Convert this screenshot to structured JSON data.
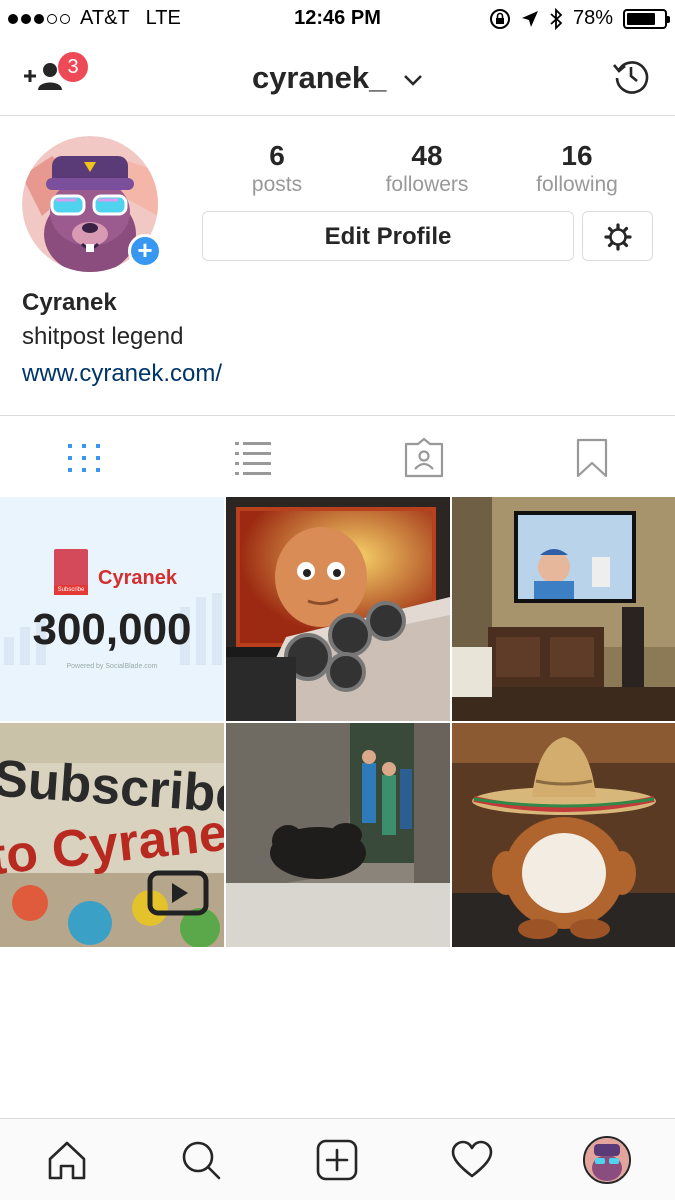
{
  "status_bar": {
    "carrier": "AT&T",
    "network": "LTE",
    "time": "12:46 PM",
    "battery": "78%",
    "battery_level": 0.78,
    "signal_bars": 3
  },
  "header": {
    "username": "cyranek_",
    "requests_badge": "3",
    "icons": {
      "left": "add-user-icon",
      "right": "history-icon"
    }
  },
  "profile": {
    "stats": [
      {
        "value": "6",
        "label": "posts"
      },
      {
        "value": "48",
        "label": "followers"
      },
      {
        "value": "16",
        "label": "following"
      }
    ],
    "edit_button": "Edit Profile",
    "name": "Cyranek",
    "bio": "shitpost legend",
    "website": "www.cyranek.com/"
  },
  "tabs": [
    {
      "name": "grid",
      "active": true
    },
    {
      "name": "list",
      "active": false
    },
    {
      "name": "tagged",
      "active": false
    },
    {
      "name": "saved",
      "active": false
    }
  ],
  "posts": {
    "sub_card": {
      "channel": "Cyranek",
      "count": "300,000",
      "button": "Subscribe",
      "footer": "Powered by SocialBlade.com"
    },
    "graffiti": "Subscribe to Cyranek"
  },
  "colors": {
    "accent_blue": "#3897f0",
    "badge_red": "#ed4956",
    "link": "#003569",
    "muted": "#999999",
    "border": "#dbdbdb"
  }
}
